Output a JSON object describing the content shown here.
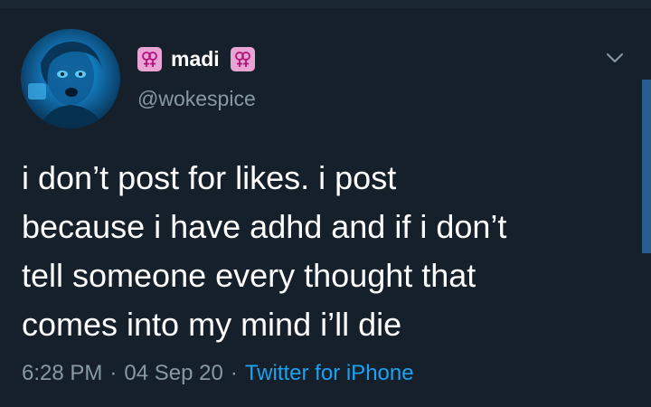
{
  "tweet": {
    "display_name": "madi",
    "name_emoji_icon": "female-sign-box-icon",
    "handle": "@wokespice",
    "text_lines": [
      "i don’t post for likes. i post",
      "because i have adhd and if i don’t",
      "tell someone every thought that",
      "comes into my mind i’ll die"
    ],
    "time": "6:28 PM",
    "date": "04 Sep 20",
    "separator": "·",
    "source": "Twitter for iPhone",
    "menu_icon": "chevron-down-icon"
  },
  "colors": {
    "background": "#15202b",
    "text": "#ffffff",
    "secondary_text": "#8899a6",
    "link": "#1da1f2",
    "emoji_badge": "#e9a3d4",
    "scrollbar": "#2a5d8f"
  }
}
